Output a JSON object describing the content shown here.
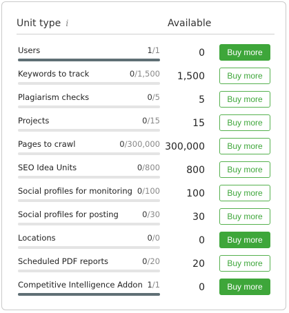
{
  "header": {
    "unit_type": "Unit type",
    "info_icon": "info-icon",
    "available": "Available"
  },
  "rows": [
    {
      "label": "Users",
      "used": "1",
      "limit": "/1",
      "used_fraction": 1.0,
      "available": "0",
      "button": "Buy more",
      "button_style": "solid"
    },
    {
      "label": "Keywords to track",
      "used": "0",
      "limit": "/1,500",
      "used_fraction": 0.0,
      "available": "1,500",
      "button": "Buy more",
      "button_style": "outline"
    },
    {
      "label": "Plagiarism checks",
      "used": "0",
      "limit": "/5",
      "used_fraction": 0.0,
      "available": "5",
      "button": "Buy more",
      "button_style": "outline"
    },
    {
      "label": "Projects",
      "used": "0",
      "limit": "/15",
      "used_fraction": 0.0,
      "available": "15",
      "button": "Buy more",
      "button_style": "outline"
    },
    {
      "label": "Pages to crawl",
      "used": "0",
      "limit": "/300,000",
      "used_fraction": 0.0,
      "available": "300,000",
      "button": "Buy more",
      "button_style": "outline"
    },
    {
      "label": "SEO Idea Units",
      "used": "0",
      "limit": "/800",
      "used_fraction": 0.0,
      "available": "800",
      "button": "Buy more",
      "button_style": "outline"
    },
    {
      "label": "Social profiles for monitoring",
      "used": "0",
      "limit": "/100",
      "used_fraction": 0.0,
      "available": "100",
      "button": "Buy more",
      "button_style": "outline"
    },
    {
      "label": "Social profiles for posting",
      "used": "0",
      "limit": "/30",
      "used_fraction": 0.0,
      "available": "30",
      "button": "Buy more",
      "button_style": "outline"
    },
    {
      "label": "Locations",
      "used": "0",
      "limit": "/0",
      "used_fraction": 0.0,
      "available": "0",
      "button": "Buy more",
      "button_style": "solid"
    },
    {
      "label": "Scheduled PDF reports",
      "used": "0",
      "limit": "/20",
      "used_fraction": 0.0,
      "available": "20",
      "button": "Buy more",
      "button_style": "outline"
    },
    {
      "label": "Competitive Intelligence Addon",
      "used": "1",
      "limit": "/1",
      "used_fraction": 1.0,
      "available": "0",
      "button": "Buy more",
      "button_style": "solid"
    }
  ],
  "colors": {
    "button_green": "#3ea63a",
    "bar_fill": "#5f6f75",
    "bar_track": "#e4e4e4"
  }
}
